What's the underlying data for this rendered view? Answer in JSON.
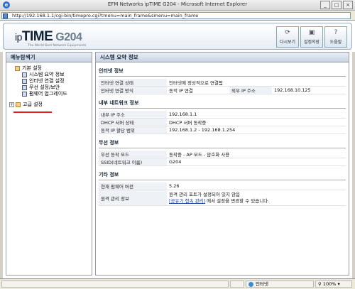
{
  "window": {
    "title": "EFM Networks ipTIME G204 - Microsoft Internet Explorer",
    "minimize": "_",
    "maximize": "□",
    "close": "×"
  },
  "address": {
    "url": "http://192.168.1.1/cgi-bin/timepro.cgi?tmenu=main_frame&smenu=main_frame"
  },
  "header": {
    "logo_prefix": "ip",
    "logo_main": "TIME",
    "model": "G204",
    "tagline": "The World Best Network Equipments",
    "buttons": [
      {
        "label": "다시보기",
        "icon": "refresh-icon"
      },
      {
        "label": "설정저장",
        "icon": "save-icon"
      },
      {
        "label": "도움말",
        "icon": "help-icon"
      }
    ]
  },
  "sidebar": {
    "title": "메뉴탐색기",
    "basic_label": "기본 설정",
    "items": [
      {
        "label": "시스템 요약 정보"
      },
      {
        "label": "인터넷 연결 설정"
      },
      {
        "label": "무선 설정/보안"
      },
      {
        "label": "펌웨어 업그레이드"
      }
    ],
    "advanced_label": "고급 설정",
    "accent_color": "#e02020"
  },
  "main": {
    "title": "시스템 요약 정보",
    "sections": {
      "internet": {
        "title": "인터넷 정보",
        "rows": [
          {
            "label": "인터넷 연결 상태",
            "value": "인터넷에 정상적으로 연결됨"
          },
          {
            "label": "인터넷 연결 방식",
            "value": "동적 IP 연결",
            "label2": "외부 IP 주소",
            "value2": "192.168.10.125"
          }
        ]
      },
      "lan": {
        "title": "내부 네트워크 정보",
        "rows": [
          {
            "label": "내부 IP 주소",
            "value": "192.168.1.1"
          },
          {
            "label": "DHCP 서버 상태",
            "value": "DHCP 서버 동작중"
          },
          {
            "label": "동적 IP 할당 범위",
            "value": "192.168.1.2 - 192.168.1.254"
          }
        ]
      },
      "wireless": {
        "title": "무선 정보",
        "rows": [
          {
            "label": "무선 동작 모드",
            "value": "동작중 - AP 모드 - 암호화 사용"
          },
          {
            "label": "SSID(네트워크 이름)",
            "value": "G204"
          }
        ]
      },
      "etc": {
        "title": "기타 정보",
        "rows": [
          {
            "label": "현재 펌웨어 버전",
            "value": "5.26"
          },
          {
            "label": "원격 관리 정보",
            "value": "원격 관리 포트가 설정되어 있지 않음",
            "link": "[공유기 접속 관리]",
            "after_link": "에서 설정을 변경할 수 있습니다."
          }
        ]
      }
    }
  },
  "status": {
    "zone": "인터넷",
    "zoom": "100%"
  }
}
